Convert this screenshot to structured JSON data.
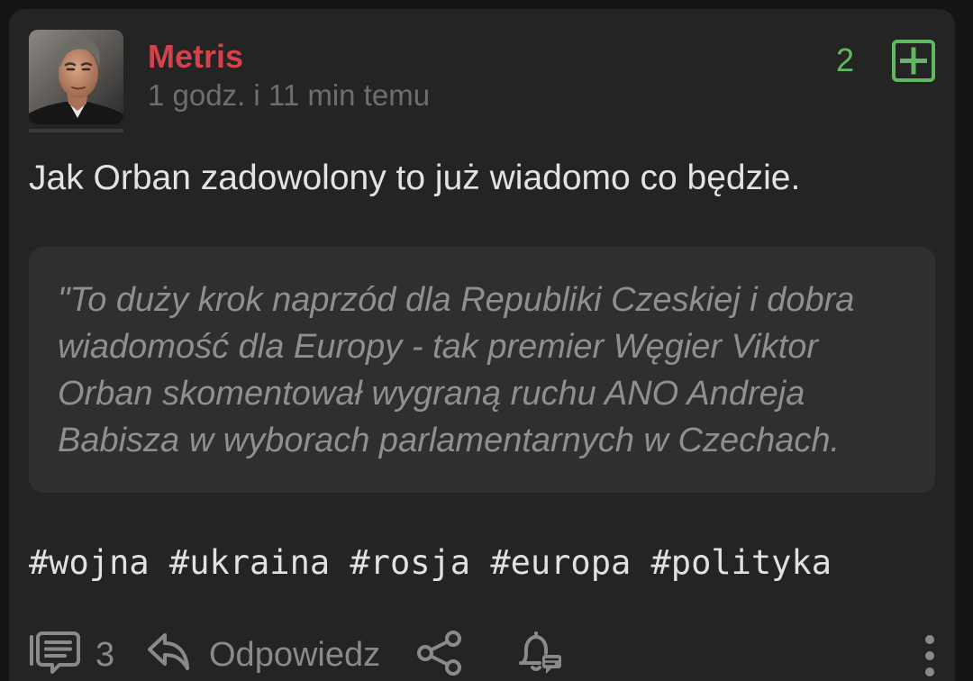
{
  "colors": {
    "page_background": "#141414",
    "card_background": "#242424",
    "author_name": "#d4424b",
    "vote_green": "#62b862",
    "quote_background": "#2f2f2f",
    "muted": "#8a8a8a"
  },
  "post": {
    "author": {
      "name": "Metris",
      "avatar_icon": "avatar-photo"
    },
    "time_ago": "1 godz. i 11 min temu",
    "vote": {
      "count": "2",
      "plus_icon": "plus-square-icon"
    },
    "body": "Jak Orban zadowolony to już wiadomo co będzie.",
    "quote_lines": [
      "\"To duży krok naprzód dla Republiki Czeskiej i dobra",
      "wiadomość dla Europy - tak premier Węgier Viktor",
      "Orban skomentował wygraną ruchu ANO Andreja",
      "Babisza w wyborach parlamentarnych w Czechach."
    ],
    "tags": [
      "#wojna",
      "#ukraina",
      "#rosja",
      "#europa",
      "#polityka"
    ],
    "actions": {
      "comments": {
        "icon": "comment-icon",
        "count": "3"
      },
      "reply": {
        "icon": "reply-icon",
        "label": "Odpowiedz"
      },
      "share": {
        "icon": "share-icon"
      },
      "observe": {
        "icon": "bell-icon"
      },
      "more": {
        "icon": "more-vertical-icon"
      }
    }
  }
}
